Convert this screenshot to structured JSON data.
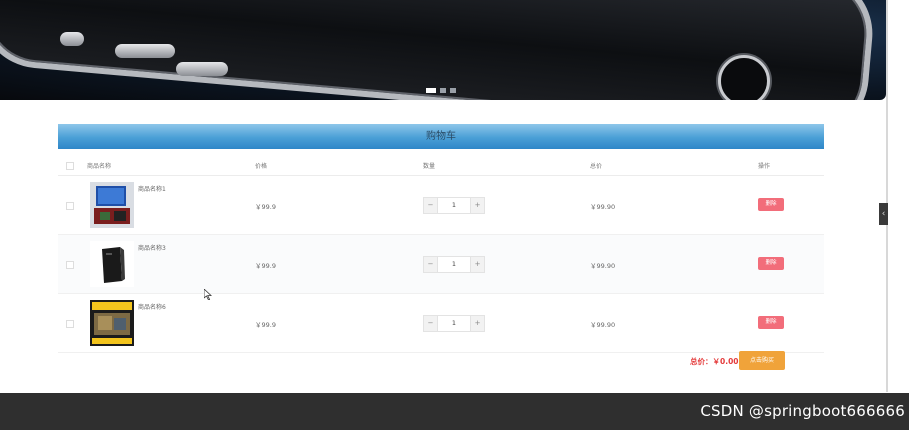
{
  "banner": {
    "slide_count": 3,
    "active_slide": 1
  },
  "cart": {
    "title": "购物车",
    "columns": {
      "name": "商品名称",
      "price": "价格",
      "quantity": "数量",
      "total": "总价",
      "action": "操作"
    },
    "rows": [
      {
        "name": "商品名称1",
        "price": "￥99.9",
        "quantity": "1",
        "total": "￥99.90",
        "delete": "删除",
        "minus": "−",
        "plus": "+"
      },
      {
        "name": "商品名称3",
        "price": "￥99.9",
        "quantity": "1",
        "total": "￥99.90",
        "delete": "删除",
        "minus": "−",
        "plus": "+"
      },
      {
        "name": "商品名称6",
        "price": "￥99.9",
        "quantity": "1",
        "total": "￥99.90",
        "delete": "删除",
        "minus": "−",
        "plus": "+"
      }
    ],
    "summary_label": "总价：￥0.00",
    "buy_button": "点击购买"
  },
  "side_tab_icon": "chevron-left-icon",
  "watermark": "CSDN @springboot666666",
  "colors": {
    "header_blue": "#4a9fd6",
    "delete_red": "#f26d7a",
    "buy_orange": "#f0a33a",
    "price_red": "#e43b3b",
    "footer": "#2f2f2f"
  }
}
